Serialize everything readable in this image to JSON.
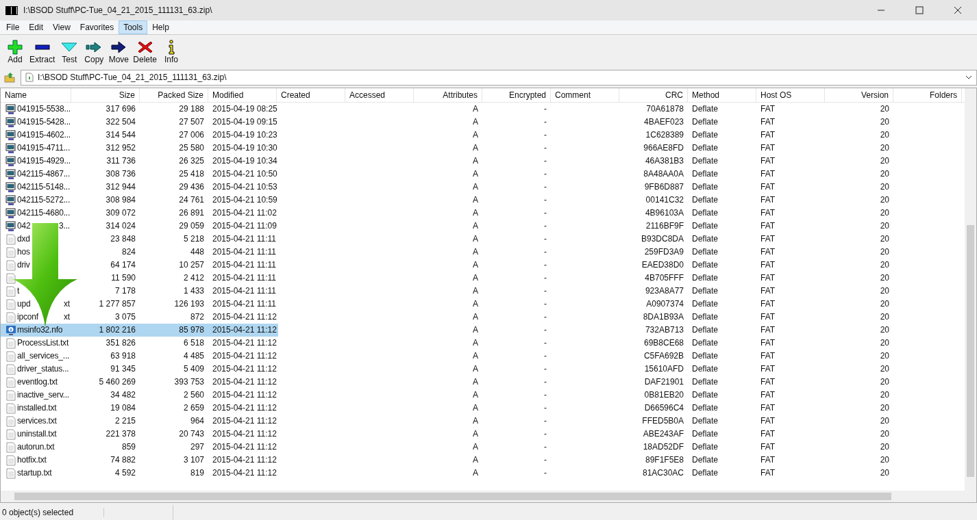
{
  "window": {
    "title": "I:\\BSOD Stuff\\PC-Tue_04_21_2015_111131_63.zip\\"
  },
  "menu": [
    {
      "label": "File",
      "selected": false
    },
    {
      "label": "Edit",
      "selected": false
    },
    {
      "label": "View",
      "selected": false
    },
    {
      "label": "Favorites",
      "selected": false
    },
    {
      "label": "Tools",
      "selected": true
    },
    {
      "label": "Help",
      "selected": false
    }
  ],
  "toolbar": [
    {
      "kind": "add",
      "label": "Add"
    },
    {
      "kind": "extract",
      "label": "Extract"
    },
    {
      "kind": "test",
      "label": "Test"
    },
    {
      "kind": "copy",
      "label": "Copy"
    },
    {
      "kind": "move",
      "label": "Move"
    },
    {
      "kind": "delete",
      "label": "Delete"
    },
    {
      "kind": "info",
      "label": "Info"
    }
  ],
  "address": {
    "value": "I:\\BSOD Stuff\\PC-Tue_04_21_2015_111131_63.zip\\"
  },
  "table": {
    "columns": [
      "Name",
      "Size",
      "Packed Size",
      "Modified",
      "Created",
      "Accessed",
      "Attributes",
      "Encrypted",
      "Comment",
      "CRC",
      "Method",
      "Host OS",
      "Version",
      "Folders"
    ],
    "rows": [
      {
        "kind": "dump",
        "selected": false,
        "name": "041915-5538...",
        "size": "317 696",
        "packed": "29 188",
        "modified": "2015-04-19 08:25",
        "attributes": "A",
        "encrypted": "-",
        "crc": "70A61878",
        "method": "Deflate",
        "host_os": "FAT",
        "version": "20"
      },
      {
        "kind": "dump",
        "selected": false,
        "name": "041915-5428...",
        "size": "322 504",
        "packed": "27 507",
        "modified": "2015-04-19 09:15",
        "attributes": "A",
        "encrypted": "-",
        "crc": "4BAEF023",
        "method": "Deflate",
        "host_os": "FAT",
        "version": "20"
      },
      {
        "kind": "dump",
        "selected": false,
        "name": "041915-4602...",
        "size": "314 544",
        "packed": "27 006",
        "modified": "2015-04-19 10:23",
        "attributes": "A",
        "encrypted": "-",
        "crc": "1C628389",
        "method": "Deflate",
        "host_os": "FAT",
        "version": "20"
      },
      {
        "kind": "dump",
        "selected": false,
        "name": "041915-4711...",
        "size": "312 952",
        "packed": "25 580",
        "modified": "2015-04-19 10:30",
        "attributes": "A",
        "encrypted": "-",
        "crc": "966AE8FD",
        "method": "Deflate",
        "host_os": "FAT",
        "version": "20"
      },
      {
        "kind": "dump",
        "selected": false,
        "name": "041915-4929...",
        "size": "311 736",
        "packed": "26 325",
        "modified": "2015-04-19 10:34",
        "attributes": "A",
        "encrypted": "-",
        "crc": "46A381B3",
        "method": "Deflate",
        "host_os": "FAT",
        "version": "20"
      },
      {
        "kind": "dump",
        "selected": false,
        "name": "042115-4867...",
        "size": "308 736",
        "packed": "25 418",
        "modified": "2015-04-21 10:50",
        "attributes": "A",
        "encrypted": "-",
        "crc": "8A48AA0A",
        "method": "Deflate",
        "host_os": "FAT",
        "version": "20"
      },
      {
        "kind": "dump",
        "selected": false,
        "name": "042115-5148...",
        "size": "312 944",
        "packed": "29 436",
        "modified": "2015-04-21 10:53",
        "attributes": "A",
        "encrypted": "-",
        "crc": "9FB6D887",
        "method": "Deflate",
        "host_os": "FAT",
        "version": "20"
      },
      {
        "kind": "dump",
        "selected": false,
        "name": "042115-5272...",
        "size": "308 984",
        "packed": "24 761",
        "modified": "2015-04-21 10:59",
        "attributes": "A",
        "encrypted": "-",
        "crc": "00141C32",
        "method": "Deflate",
        "host_os": "FAT",
        "version": "20"
      },
      {
        "kind": "dump",
        "selected": false,
        "name": "042115-4680...",
        "size": "309 072",
        "packed": "26 891",
        "modified": "2015-04-21 11:02",
        "attributes": "A",
        "encrypted": "-",
        "crc": "4B96103A",
        "method": "Deflate",
        "host_os": "FAT",
        "version": "20"
      },
      {
        "kind": "dump",
        "selected": false,
        "name": "042",
        "name_tail": "3...",
        "size": "314 024",
        "packed": "29 059",
        "modified": "2015-04-21 11:09",
        "attributes": "A",
        "encrypted": "-",
        "crc": "2116BF9F",
        "method": "Deflate",
        "host_os": "FAT",
        "version": "20"
      },
      {
        "kind": "text",
        "selected": false,
        "name": "dxd",
        "size": "23 848",
        "packed": "5 218",
        "modified": "2015-04-21 11:11",
        "attributes": "A",
        "encrypted": "-",
        "crc": "B93DC8DA",
        "method": "Deflate",
        "host_os": "FAT",
        "version": "20"
      },
      {
        "kind": "text",
        "selected": false,
        "name": "hos",
        "size": "824",
        "packed": "448",
        "modified": "2015-04-21 11:11",
        "attributes": "A",
        "encrypted": "-",
        "crc": "259FD3A9",
        "method": "Deflate",
        "host_os": "FAT",
        "version": "20"
      },
      {
        "kind": "text",
        "selected": false,
        "name": "driv",
        "size": "64 174",
        "packed": "10 257",
        "modified": "2015-04-21 11:11",
        "attributes": "A",
        "encrypted": "-",
        "crc": "EAED38D0",
        "method": "Deflate",
        "host_os": "FAT",
        "version": "20"
      },
      {
        "kind": "text",
        "selected": false,
        "size": "11 590",
        "packed": "2 412",
        "modified": "2015-04-21 11:11",
        "attributes": "A",
        "encrypted": "-",
        "crc": "4B705FFF",
        "method": "Deflate",
        "host_os": "FAT",
        "version": "20"
      },
      {
        "kind": "text",
        "selected": false,
        "name": "t",
        "size": "7 178",
        "packed": "1 433",
        "modified": "2015-04-21 11:11",
        "attributes": "A",
        "encrypted": "-",
        "crc": "923A8A77",
        "method": "Deflate",
        "host_os": "FAT",
        "version": "20"
      },
      {
        "kind": "text",
        "selected": false,
        "name": "upd",
        "name_tail": "xt",
        "size": "1 277 857",
        "packed": "126 193",
        "modified": "2015-04-21 11:11",
        "attributes": "A",
        "encrypted": "-",
        "crc": "A0907374",
        "method": "Deflate",
        "host_os": "FAT",
        "version": "20"
      },
      {
        "kind": "text",
        "selected": false,
        "name": "ipconf",
        "name_tail": "xt",
        "size": "3 075",
        "packed": "872",
        "modified": "2015-04-21 11:12",
        "attributes": "A",
        "encrypted": "-",
        "crc": "8DA1B93A",
        "method": "Deflate",
        "host_os": "FAT",
        "version": "20"
      },
      {
        "kind": "info",
        "selected": true,
        "name": "msinfo32.nfo",
        "size": "1 802 216",
        "packed": "85 978",
        "modified": "2015-04-21 11:12",
        "attributes": "A",
        "encrypted": "-",
        "crc": "732AB713",
        "method": "Deflate",
        "host_os": "FAT",
        "version": "20"
      },
      {
        "kind": "text",
        "selected": false,
        "name": "ProcessList.txt",
        "size": "351 826",
        "packed": "6 518",
        "modified": "2015-04-21 11:12",
        "attributes": "A",
        "encrypted": "-",
        "crc": "69B8CE68",
        "method": "Deflate",
        "host_os": "FAT",
        "version": "20"
      },
      {
        "kind": "text",
        "selected": false,
        "name": "all_services_...",
        "size": "63 918",
        "packed": "4 485",
        "modified": "2015-04-21 11:12",
        "attributes": "A",
        "encrypted": "-",
        "crc": "C5FA692B",
        "method": "Deflate",
        "host_os": "FAT",
        "version": "20"
      },
      {
        "kind": "text",
        "selected": false,
        "name": "driver_status...",
        "size": "91 345",
        "packed": "5 409",
        "modified": "2015-04-21 11:12",
        "attributes": "A",
        "encrypted": "-",
        "crc": "15610AFD",
        "method": "Deflate",
        "host_os": "FAT",
        "version": "20"
      },
      {
        "kind": "text",
        "selected": false,
        "name": "eventlog.txt",
        "size": "5 460 269",
        "packed": "393 753",
        "modified": "2015-04-21 11:12",
        "attributes": "A",
        "encrypted": "-",
        "crc": "DAF21901",
        "method": "Deflate",
        "host_os": "FAT",
        "version": "20"
      },
      {
        "kind": "text",
        "selected": false,
        "name": "inactive_serv...",
        "size": "34 482",
        "packed": "2 560",
        "modified": "2015-04-21 11:12",
        "attributes": "A",
        "encrypted": "-",
        "crc": "0B81EB20",
        "method": "Deflate",
        "host_os": "FAT",
        "version": "20"
      },
      {
        "kind": "text",
        "selected": false,
        "name": "installed.txt",
        "size": "19 084",
        "packed": "2 659",
        "modified": "2015-04-21 11:12",
        "attributes": "A",
        "encrypted": "-",
        "crc": "D66596C4",
        "method": "Deflate",
        "host_os": "FAT",
        "version": "20"
      },
      {
        "kind": "text",
        "selected": false,
        "name": "services.txt",
        "size": "2 215",
        "packed": "964",
        "modified": "2015-04-21 11:12",
        "attributes": "A",
        "encrypted": "-",
        "crc": "FFED5B0A",
        "method": "Deflate",
        "host_os": "FAT",
        "version": "20"
      },
      {
        "kind": "text",
        "selected": false,
        "name": "uninstall.txt",
        "size": "221 378",
        "packed": "20 743",
        "modified": "2015-04-21 11:12",
        "attributes": "A",
        "encrypted": "-",
        "crc": "ABE243AF",
        "method": "Deflate",
        "host_os": "FAT",
        "version": "20"
      },
      {
        "kind": "text",
        "selected": false,
        "name": "autorun.txt",
        "size": "859",
        "packed": "297",
        "modified": "2015-04-21 11:12",
        "attributes": "A",
        "encrypted": "-",
        "crc": "18AD52DF",
        "method": "Deflate",
        "host_os": "FAT",
        "version": "20"
      },
      {
        "kind": "text",
        "selected": false,
        "name": "hotfix.txt",
        "size": "74 882",
        "packed": "3 107",
        "modified": "2015-04-21 11:12",
        "attributes": "A",
        "encrypted": "-",
        "crc": "89F1F5E8",
        "method": "Deflate",
        "host_os": "FAT",
        "version": "20"
      },
      {
        "kind": "text",
        "selected": false,
        "name": "startup.txt",
        "size": "4 592",
        "packed": "819",
        "modified": "2015-04-21 11:12",
        "attributes": "A",
        "encrypted": "-",
        "crc": "81AC30AC",
        "method": "Deflate",
        "host_os": "FAT",
        "version": "20"
      }
    ]
  },
  "status_bar": {
    "text": "0 object(s) selected"
  }
}
